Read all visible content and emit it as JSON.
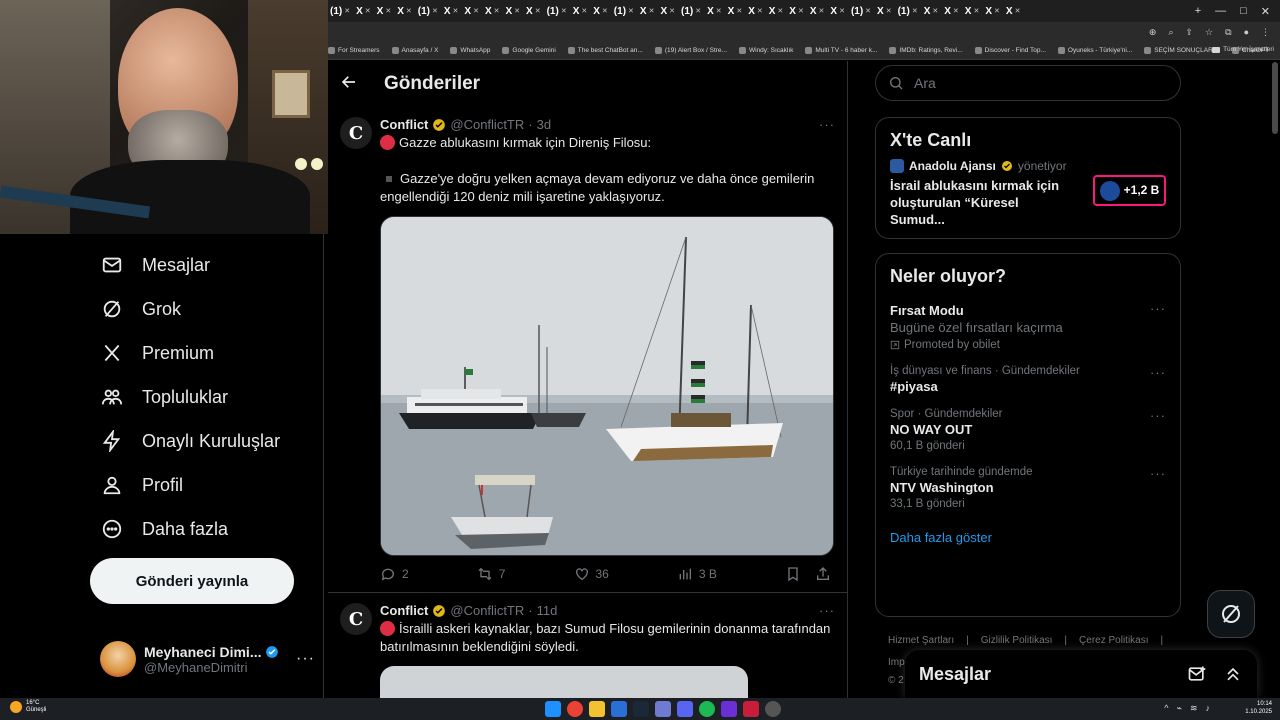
{
  "browser": {
    "tabs": [
      "(1)",
      "X",
      "X",
      "X",
      "(1)",
      "X",
      "X",
      "X",
      "X",
      "X",
      "(1)",
      "X",
      "X",
      "(1)",
      "X",
      "X",
      "(1)",
      "X",
      "X",
      "X",
      "X",
      "X",
      "X",
      "X",
      "(1)",
      "X",
      "(1)",
      "X",
      "X",
      "X",
      "X",
      "X"
    ],
    "bookmarks": [
      "For Streamers",
      "Anasayfa / X",
      "WhatsApp",
      "Google Gemini",
      "The best ChatBot an...",
      "(19) Alert Box / Stre...",
      "Windy: Sıcaklık",
      "Multi TV - 6 haber k...",
      "IMDb: Ratings, Revi...",
      "Discover - Find Top...",
      "Oyuneks - Türkiye'ni...",
      "SEÇİM SONUÇLARI...",
      "ChatGPT"
    ],
    "bookmarks_more": "»",
    "all_bookmarks": "Tüm Yer İşaretleri"
  },
  "nav": {
    "items": [
      {
        "label": "Mesajlar",
        "icon": "mail-icon"
      },
      {
        "label": "Grok",
        "icon": "grok-icon"
      },
      {
        "label": "Premium",
        "icon": "x-logo-icon"
      },
      {
        "label": "Topluluklar",
        "icon": "communities-icon"
      },
      {
        "label": "Onaylı Kuruluşlar",
        "icon": "lightning-icon"
      },
      {
        "label": "Profil",
        "icon": "person-icon"
      },
      {
        "label": "Daha fazla",
        "icon": "more-circle-icon"
      }
    ],
    "post_button": "Gönderi yayınla",
    "account": {
      "display_name": "Meyhaneci Dimi...",
      "handle": "@MeyhaneDimitri",
      "more": "···"
    }
  },
  "main": {
    "title": "Gönderiler",
    "tweets": [
      {
        "name": "Conflict",
        "handle": "@ConflictTR",
        "date": "3d",
        "line1": "Gazze ablukasını kırmak için Direniş Filosu:",
        "line2": "Gazze'ye doğru yelken açmaya devam ediyoruz ve daha önce gemilerin engellendiği 120 deniz mili işaretine yaklaşıyoruz.",
        "replies": "2",
        "reposts": "7",
        "likes": "36",
        "views": "3 B"
      },
      {
        "name": "Conflict",
        "handle": "@ConflictTR",
        "date": "11d",
        "line1": "İsrailli askeri kaynaklar, bazı Sumud Filosu gemilerinin donanma tarafından batırılmasının beklendiğini söyledi."
      }
    ]
  },
  "right": {
    "search_placeholder": "Ara",
    "live": {
      "title": "X'te Canlı",
      "source": "Anadolu Ajansı",
      "status": "yönetiyor",
      "headline": "İsrail ablukasını kırmak için oluşturulan “Küresel Sumud...",
      "listeners": "+1,2 B"
    },
    "trends": {
      "title": "Neler oluyor?",
      "items": [
        {
          "context": "",
          "title": "Fırsat Modu",
          "subtitle": "Bugüne özel fırsatları kaçırma",
          "extra": "Promoted by obilet"
        },
        {
          "context": "İş dünyası ve finans · Gündemdekiler",
          "title": "#piyasa",
          "subtitle": "",
          "extra": ""
        },
        {
          "context": "Spor · Gündemdekiler",
          "title": "NO WAY OUT",
          "subtitle": "",
          "extra": "60,1 B gönderi"
        },
        {
          "context": "Türkiye tarihinde gündemde",
          "title": "NTV Washington",
          "subtitle": "",
          "extra": "33,1 B gönderi"
        }
      ],
      "show_more": "Daha fazla göster"
    },
    "footer": [
      "Hizmet Şartları",
      "Gizlilik Politikası",
      "Çerez Politikası"
    ],
    "footer_cut": "Imp",
    "footer_copy": "© 2"
  },
  "dm_drawer": {
    "title": "Mesajlar"
  },
  "taskbar": {
    "weather_temp": "16°C",
    "weather_desc": "Güneşli",
    "time": "10:14",
    "date": "1.10.2025"
  },
  "colors": {
    "accent": "#1d9bf0",
    "verified": "#1d9bf0",
    "live_border": "#f91880",
    "red_circle": "#dd2e44"
  }
}
